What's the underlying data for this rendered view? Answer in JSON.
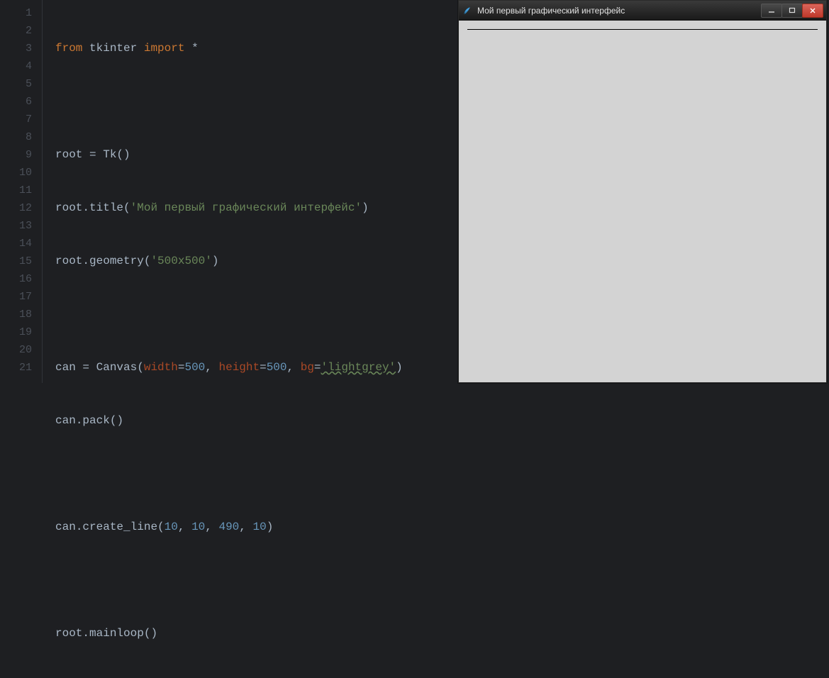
{
  "gutter": {
    "lines": [
      "1",
      "2",
      "3",
      "4",
      "5",
      "6",
      "7",
      "8",
      "9",
      "10",
      "11",
      "12",
      "13",
      "14",
      "15",
      "16",
      "17",
      "18",
      "19",
      "20",
      "21"
    ]
  },
  "code": {
    "l1": {
      "from": "from",
      "mod": "tkinter",
      "import": "import",
      "star": "*"
    },
    "l3": {
      "root": "root",
      "eq": " = ",
      "tk": "Tk",
      "po": "(",
      "pc": ")"
    },
    "l4": {
      "root": "root",
      "dot": ".",
      "title": "title",
      "po": "(",
      "str": "'Мой первый графический интерфейс'",
      "pc": ")"
    },
    "l5": {
      "root": "root",
      "dot": ".",
      "geom": "geometry",
      "po": "(",
      "str": "'500x500'",
      "pc": ")"
    },
    "l7": {
      "can": "can",
      "eq": " = ",
      "canvas": "Canvas",
      "po": "(",
      "width": "width",
      "e1": "=",
      "n1": "500",
      "c1": ", ",
      "height": "height",
      "e2": "=",
      "n2": "500",
      "c2": ", ",
      "bg": "bg",
      "e3": "=",
      "str": "'lightgrey'",
      "pc": ")"
    },
    "l8": {
      "can": "can",
      "dot": ".",
      "pack": "pack",
      "po": "(",
      "pc": ")"
    },
    "l10": {
      "can": "can",
      "dot": ".",
      "cl": "create_line",
      "po": "(",
      "n1": "10",
      "c1": ", ",
      "n2": "10",
      "c2": ", ",
      "n3": "490",
      "c3": ", ",
      "n4": "10",
      "pc": ")"
    },
    "l12": {
      "root": "root",
      "dot": ".",
      "ml": "mainloop",
      "po": "(",
      "pc": ")"
    }
  },
  "tk": {
    "title": "Мой первый графический интерфейс",
    "min_label": "—",
    "max_label": "▭",
    "close_label": "✕"
  }
}
